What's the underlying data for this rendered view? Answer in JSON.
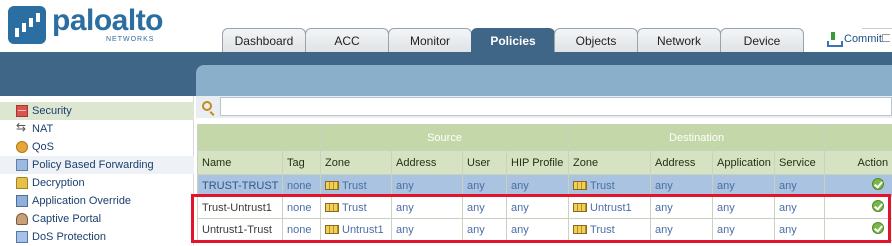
{
  "brand": {
    "name": "paloalto",
    "sub": "NETWORKS"
  },
  "tabs": [
    {
      "label": "Dashboard",
      "active": false
    },
    {
      "label": "ACC",
      "active": false
    },
    {
      "label": "Monitor",
      "active": false
    },
    {
      "label": "Policies",
      "active": true
    },
    {
      "label": "Objects",
      "active": false
    },
    {
      "label": "Network",
      "active": false
    },
    {
      "label": "Device",
      "active": false
    }
  ],
  "commit_label": "Commit",
  "sidebar": {
    "items": [
      {
        "label": "Security",
        "icon": "security-icon",
        "active": true
      },
      {
        "label": "NAT",
        "icon": "nat-icon",
        "active": false
      },
      {
        "label": "QoS",
        "icon": "qos-icon",
        "active": false
      },
      {
        "label": "Policy Based Forwarding",
        "icon": "pbf-icon",
        "active": false
      },
      {
        "label": "Decryption",
        "icon": "decryption-icon",
        "active": false
      },
      {
        "label": "Application Override",
        "icon": "app-override-icon",
        "active": false
      },
      {
        "label": "Captive Portal",
        "icon": "captive-portal-icon",
        "active": false
      },
      {
        "label": "DoS Protection",
        "icon": "dos-protection-icon",
        "active": false
      }
    ]
  },
  "search": {
    "value": "",
    "placeholder": ""
  },
  "table": {
    "groups": {
      "source": "Source",
      "destination": "Destination"
    },
    "columns": [
      "Name",
      "Tag",
      "Zone",
      "Address",
      "User",
      "HIP Profile",
      "Zone",
      "Address",
      "Application",
      "Service",
      "Action"
    ],
    "rows": [
      {
        "name": "TRUST-TRUST",
        "tag": "none",
        "src_zone": "Trust",
        "src_addr": "any",
        "user": "any",
        "hip": "any",
        "dst_zone": "Trust",
        "dst_addr": "any",
        "app": "any",
        "service": "any",
        "action": "allow",
        "selected": true
      },
      {
        "name": "Trust-Untrust1",
        "tag": "none",
        "src_zone": "Trust",
        "src_addr": "any",
        "user": "any",
        "hip": "any",
        "dst_zone": "Untrust1",
        "dst_addr": "any",
        "app": "any",
        "service": "any",
        "action": "allow",
        "selected": false
      },
      {
        "name": "Untrust1-Trust",
        "tag": "none",
        "src_zone": "Untrust1",
        "src_addr": "any",
        "user": "any",
        "hip": "any",
        "dst_zone": "Trust",
        "dst_addr": "any",
        "app": "any",
        "service": "any",
        "action": "allow",
        "selected": false
      }
    ]
  },
  "colors": {
    "accent": "#3f6587",
    "highlight": "#e3132b",
    "header_green": "#c4d7a8"
  }
}
